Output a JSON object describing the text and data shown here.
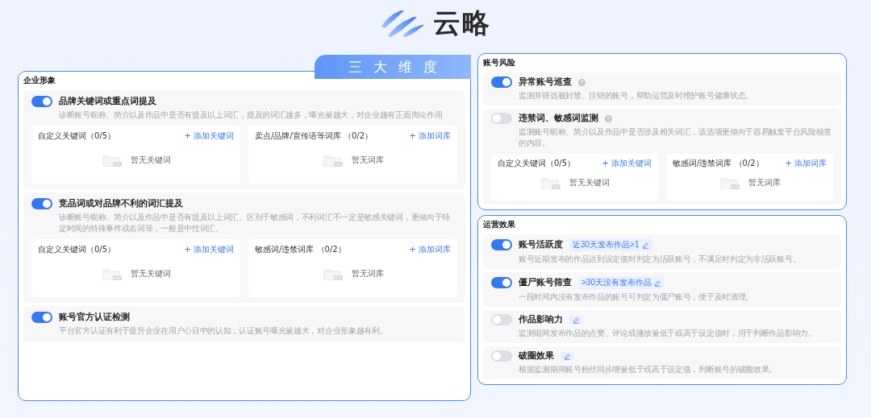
{
  "brand": {
    "name": "云略"
  },
  "dimension_tab": {
    "label": "三大维度"
  },
  "left_sections": [
    {
      "title": "企业形象",
      "items": [
        {
          "title": "品牌关键词或重点词提及",
          "on": true,
          "desc": "诊断账号昵称、简介以及作品中是否有提及以上词汇，提及的词汇越多，曝光量越大，对企业越有正面舆论作用",
          "libraries": [
            {
              "title": "自定义关键词（0/5）",
              "action": "+ 添加关键词",
              "empty": "暂无关键词"
            },
            {
              "title": "卖点/品牌/宣传语等词库 （0/2）",
              "action": "+ 添加词库",
              "empty": "暂无词库"
            }
          ]
        },
        {
          "title": "竞品词或对品牌不利的词汇提及",
          "on": true,
          "desc": "诊断账号昵称、简介以及作品中是否有提及以上词汇。区别于敏感词，不利词汇不一定是敏感关键词，更倾向于特定时间的特殊事件或名词等，一般是中性词汇。",
          "libraries": [
            {
              "title": "自定义关键词（0/5）",
              "action": "+ 添加关键词",
              "empty": "暂无关键词"
            },
            {
              "title": "敏感词/违禁词库 （0/2）",
              "action": "+ 添加词库",
              "empty": "暂无词库"
            }
          ]
        },
        {
          "title": "账号官方认证检测",
          "on": true,
          "desc": "平台官方认证有利于提升企业在用户心目中的认知，认证账号曝光量越大，对企业形象越有利。"
        }
      ]
    }
  ],
  "right_sections": [
    {
      "title": "账号风险",
      "items": [
        {
          "title": "异常账号巡查",
          "on": true,
          "help": true,
          "desc": "监测并筛选被封禁、注销的账号，帮助运营及时维护账号健康状态。"
        },
        {
          "title": "违禁词、敏感词监测",
          "on": false,
          "help": true,
          "desc": "监测账号昵称、简介以及作品中是否涉及相关词汇，该选项更倾向于容易触发平台风险核查的内容。",
          "libraries": [
            {
              "title": "自定义关键词（0/5）",
              "action": "+ 添加关键词",
              "empty": "暂无关键词"
            },
            {
              "title": "敏感词/违禁词库 （0/2）",
              "action": "+ 添加词库",
              "empty": "暂无词库"
            }
          ]
        }
      ]
    },
    {
      "title": "运营效果",
      "items": [
        {
          "title": "账号活跃度",
          "on": true,
          "editable": true,
          "condition": "近30天发布作品>1",
          "desc": "账号近期发布的作品达到设定值时判定为活跃账号，不满足时判定为非活跃账号。"
        },
        {
          "title": "僵尸账号筛查",
          "on": true,
          "editable": true,
          "condition": ">30天没有发布作品",
          "desc": "一段时间内没有发布作品的账号可判定为僵尸账号，便于及时清理。"
        },
        {
          "title": "作品影响力",
          "on": false,
          "editable": true,
          "desc": "监测期间发布作品的点赞、评论或播放量低于或高于设定值时，用于判断作品影响力。"
        },
        {
          "title": "破圈效果",
          "on": false,
          "editable": true,
          "desc": "根据监测期间账号粉丝同步增量低于或高于设定值，判断账号的破圈效果。"
        }
      ]
    }
  ]
}
